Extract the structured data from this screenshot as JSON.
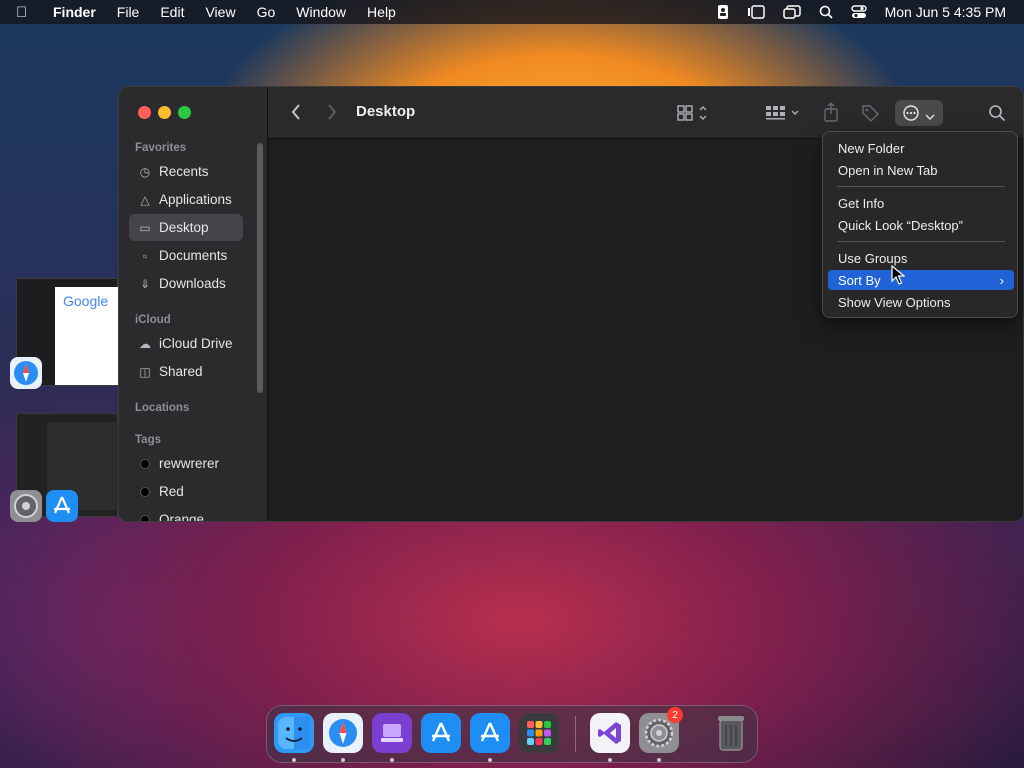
{
  "menubar": {
    "app_name": "Finder",
    "items": [
      "File",
      "Edit",
      "View",
      "Go",
      "Window",
      "Help"
    ],
    "datetime": "Mon Jun 5  4:35 PM"
  },
  "finder": {
    "title": "Desktop",
    "sidebar": {
      "favorites_title": "Favorites",
      "favorites": [
        "Recents",
        "Applications",
        "Desktop",
        "Documents",
        "Downloads"
      ],
      "icloud_title": "iCloud",
      "icloud": [
        "iCloud Drive",
        "Shared"
      ],
      "locations_title": "Locations",
      "tags_title": "Tags",
      "tags": [
        "rewwrerer",
        "Red",
        "Orange"
      ],
      "selected": "Desktop"
    }
  },
  "context_menu": {
    "items": [
      "New Folder",
      "Open in New Tab",
      "Get Info",
      "Quick Look “Desktop”",
      "Use Groups",
      "Sort By",
      "Show View Options"
    ],
    "highlighted": "Sort By"
  },
  "thumbnail": {
    "google_text": "Google"
  },
  "dock": {
    "settings_badge": "2"
  },
  "colors": {
    "accent": "#1f63d6",
    "traffic_red": "#ff5f57",
    "traffic_yellow": "#febc2e",
    "traffic_green": "#28c840"
  }
}
